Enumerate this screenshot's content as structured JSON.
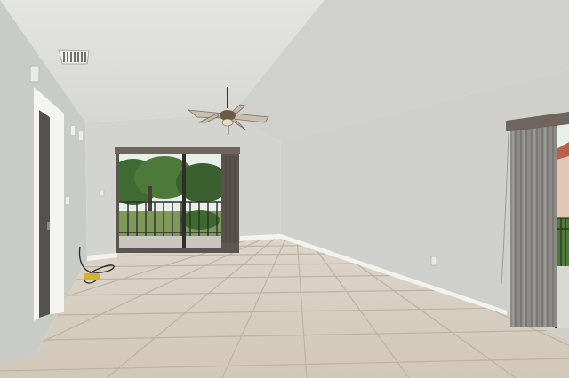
{
  "scene": {
    "colors": {
      "ceiling": "#dcdcd8",
      "wall_left": "#c9cbc7",
      "wall_back": "#d3d4d0",
      "wall_right": "#cfd0cc",
      "floor": "#d8cfc2",
      "grout": "#bdb3a5",
      "baseboard": "#f3f2ee",
      "door_frame": "#f4f4f1",
      "curtain": "#8b8a86",
      "curtain_light": "#a7a6a2",
      "valance": "#6f655e",
      "foliage": "#3f6b32",
      "lawn": "#7f9a58",
      "sky": "#e8efe9",
      "railing": "#2d2f2f"
    }
  }
}
